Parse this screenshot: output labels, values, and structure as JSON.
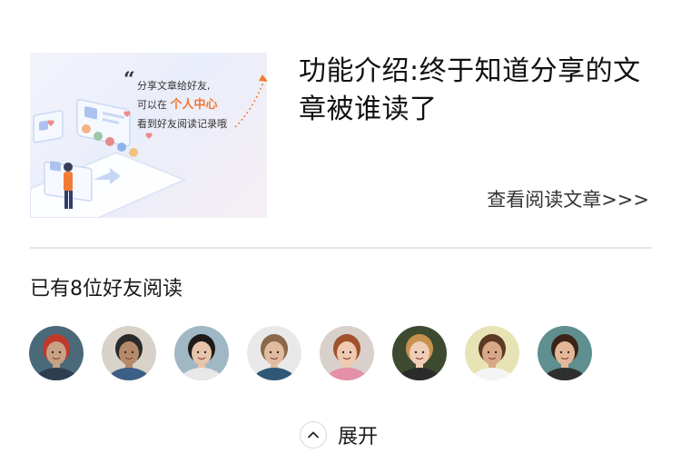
{
  "article": {
    "title": "功能介绍:终于知道分享的文章被谁读了",
    "link_label": "查看阅读文章>>>",
    "thumbnail": {
      "quote_mark": "“",
      "line1": "分享文章给好友,",
      "line2_prefix": "可以在",
      "line2_highlight": "个人中心",
      "line3": "看到好友阅读记录哦",
      "highlight_color": "#f2792d"
    }
  },
  "readers": {
    "title": "已有8位好友阅读",
    "avatars": [
      {
        "name": "reader-1",
        "bg": "#4a6a7a",
        "skin": "#c9a184",
        "hair": "#c0392b",
        "shirt": "#2c3e50"
      },
      {
        "name": "reader-2",
        "bg": "#d8d2c8",
        "skin": "#b58a6a",
        "hair": "#2b2b2b",
        "shirt": "#3b5f85"
      },
      {
        "name": "reader-3",
        "bg": "#9fb8c4",
        "skin": "#e8c4aa",
        "hair": "#1e1a18",
        "shirt": "#e8e8e8"
      },
      {
        "name": "reader-4",
        "bg": "#e9e9e9",
        "skin": "#e2bca0",
        "hair": "#8a6a4a",
        "shirt": "#2f5878"
      },
      {
        "name": "reader-5",
        "bg": "#d9d0cc",
        "skin": "#efc9b0",
        "hair": "#a0522d",
        "shirt": "#e58fa8"
      },
      {
        "name": "reader-6",
        "bg": "#3d4a30",
        "skin": "#f0cdb6",
        "hair": "#c8924e",
        "shirt": "#2b2b2b"
      },
      {
        "name": "reader-7",
        "bg": "#e8e3b4",
        "skin": "#d9a887",
        "hair": "#5a3a24",
        "shirt": "#f4f4f4"
      },
      {
        "name": "reader-8",
        "bg": "#5f8f8f",
        "skin": "#e3b89a",
        "hair": "#3a2418",
        "shirt": "#2f2f2f"
      }
    ]
  },
  "expand": {
    "label": "展开",
    "icon": "chevron-up-icon"
  }
}
